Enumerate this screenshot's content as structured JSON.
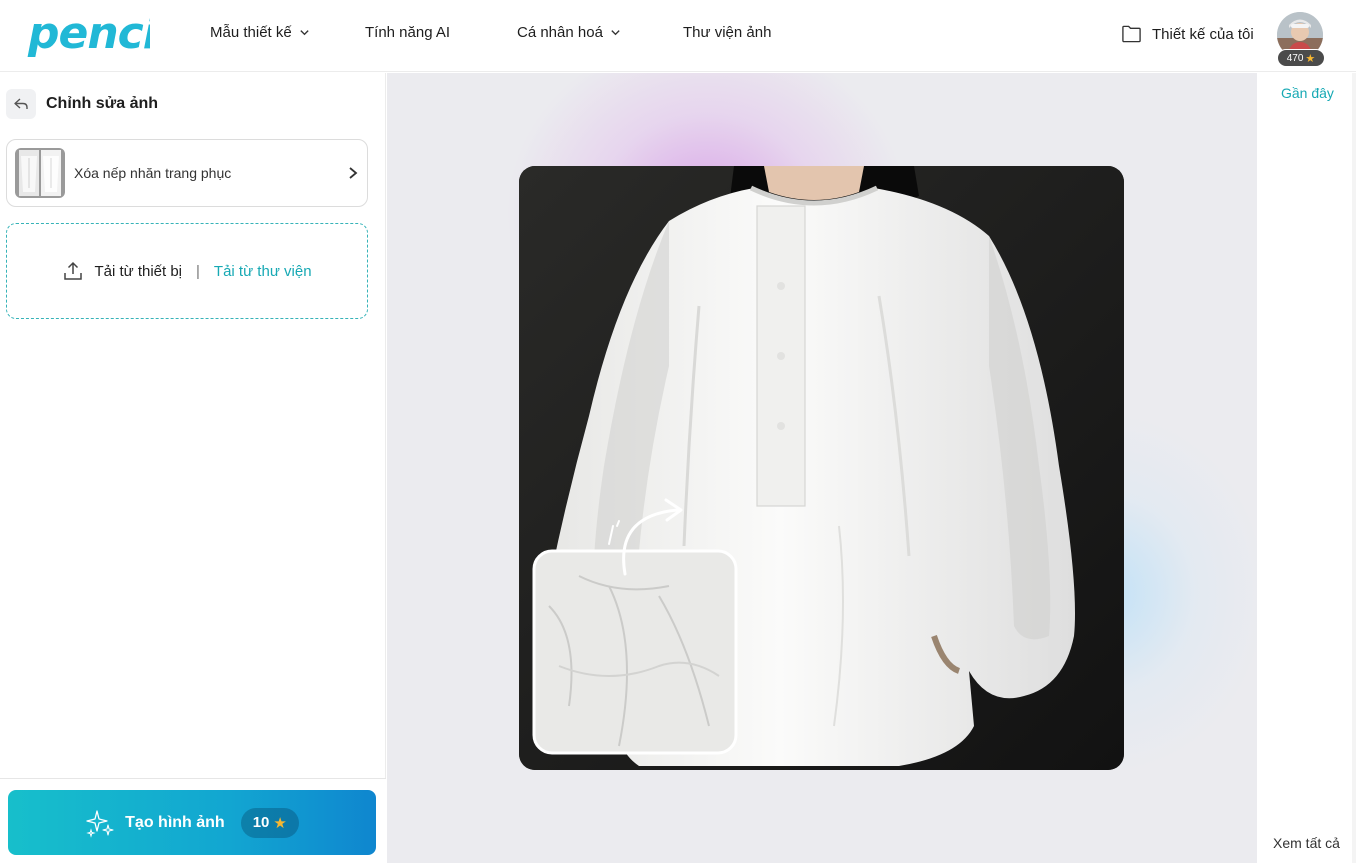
{
  "brand": {
    "logo_text": "penci",
    "logo_color": "#21b8d6"
  },
  "nav": {
    "items": [
      {
        "label": "Mẫu thiết kế",
        "has_dropdown": true
      },
      {
        "label": "Tính năng AI",
        "has_dropdown": false
      },
      {
        "label": "Cá nhân hoá",
        "has_dropdown": true
      },
      {
        "label": "Thư viện ảnh",
        "has_dropdown": false
      }
    ],
    "my_designs": {
      "label": "Thiết kế của tôi",
      "icon": "folder-icon"
    },
    "user": {
      "credits": "470",
      "credit_icon": "star-icon"
    }
  },
  "left_panel": {
    "title": "Chỉnh sửa ảnh",
    "back_icon": "back-icon",
    "tool": {
      "label": "Xóa nếp nhăn trang phục",
      "arrow_icon": "chevron-right-icon"
    },
    "upload": {
      "icon": "upload-icon",
      "device_label": "Tải từ thiết bị",
      "separator": "|",
      "library_label": "Tải từ thư viện"
    },
    "generate": {
      "label": "Tạo hình ảnh",
      "cost": "10",
      "icon": "sparkle-icon"
    }
  },
  "right_panel": {
    "recent_label": "Gần đây",
    "view_all_label": "Xem tất cả"
  },
  "colors": {
    "accent": "#17a9b4",
    "generate_start": "#17bfcb",
    "generate_end": "#0f86cf",
    "star": "#f7b731"
  }
}
